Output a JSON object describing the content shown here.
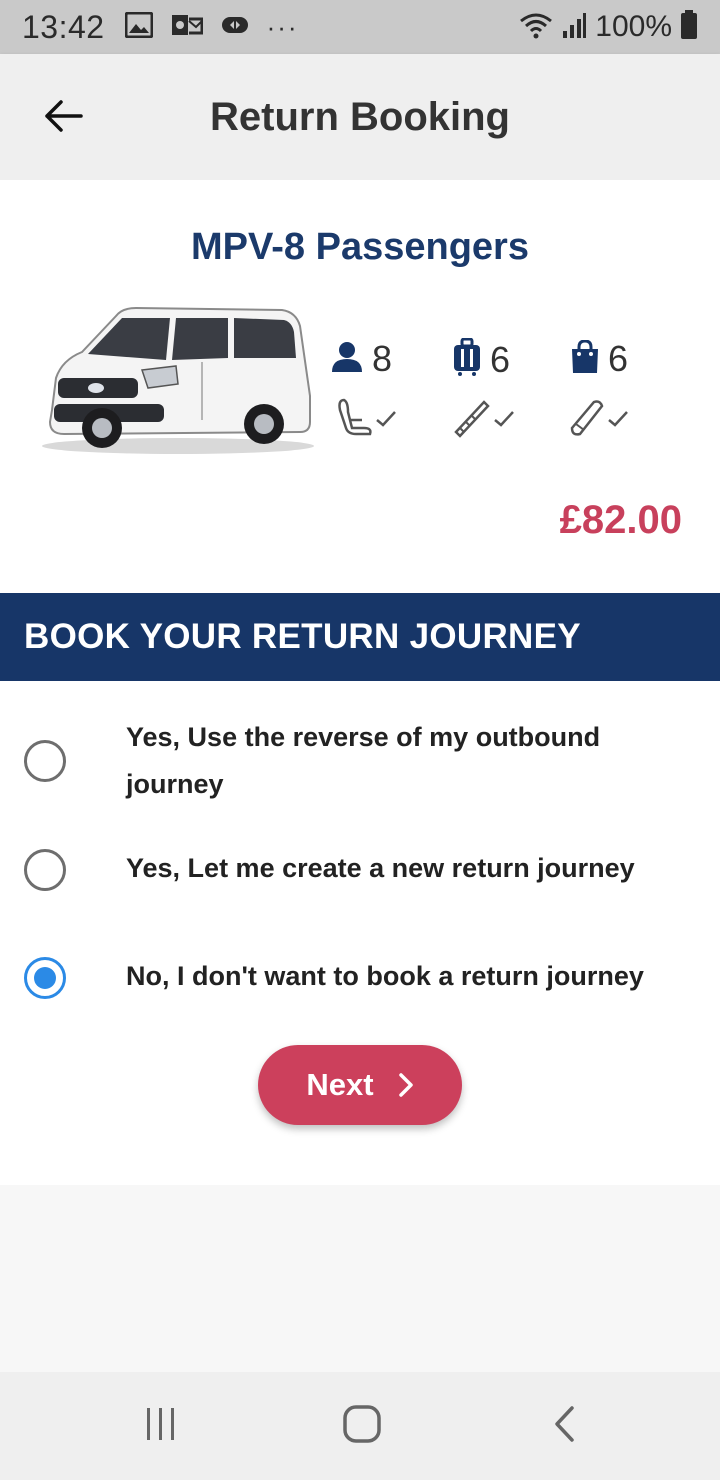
{
  "status_bar": {
    "time": "13:42",
    "battery": "100%"
  },
  "app_bar": {
    "title": "Return Booking"
  },
  "vehicle": {
    "name": "MPV-8 Passengers",
    "passengers": "8",
    "suitcases": "6",
    "bags": "6",
    "extras": [
      "baby-seat-icon",
      "skis-icon",
      "golf-bag-icon"
    ],
    "price": "£82.00"
  },
  "return_section": {
    "title": "BOOK YOUR RETURN JOURNEY",
    "options": [
      {
        "label": "Yes, Use the reverse of my outbound journey",
        "selected": false
      },
      {
        "label": "Yes, Let me create a new return journey",
        "selected": false
      },
      {
        "label": "No, I don't want to book a return journey",
        "selected": true
      }
    ],
    "next_label": "Next"
  },
  "colors": {
    "brand_navy": "#173668",
    "accent_red": "#cc405c",
    "radio_blue": "#2b8ae6"
  }
}
